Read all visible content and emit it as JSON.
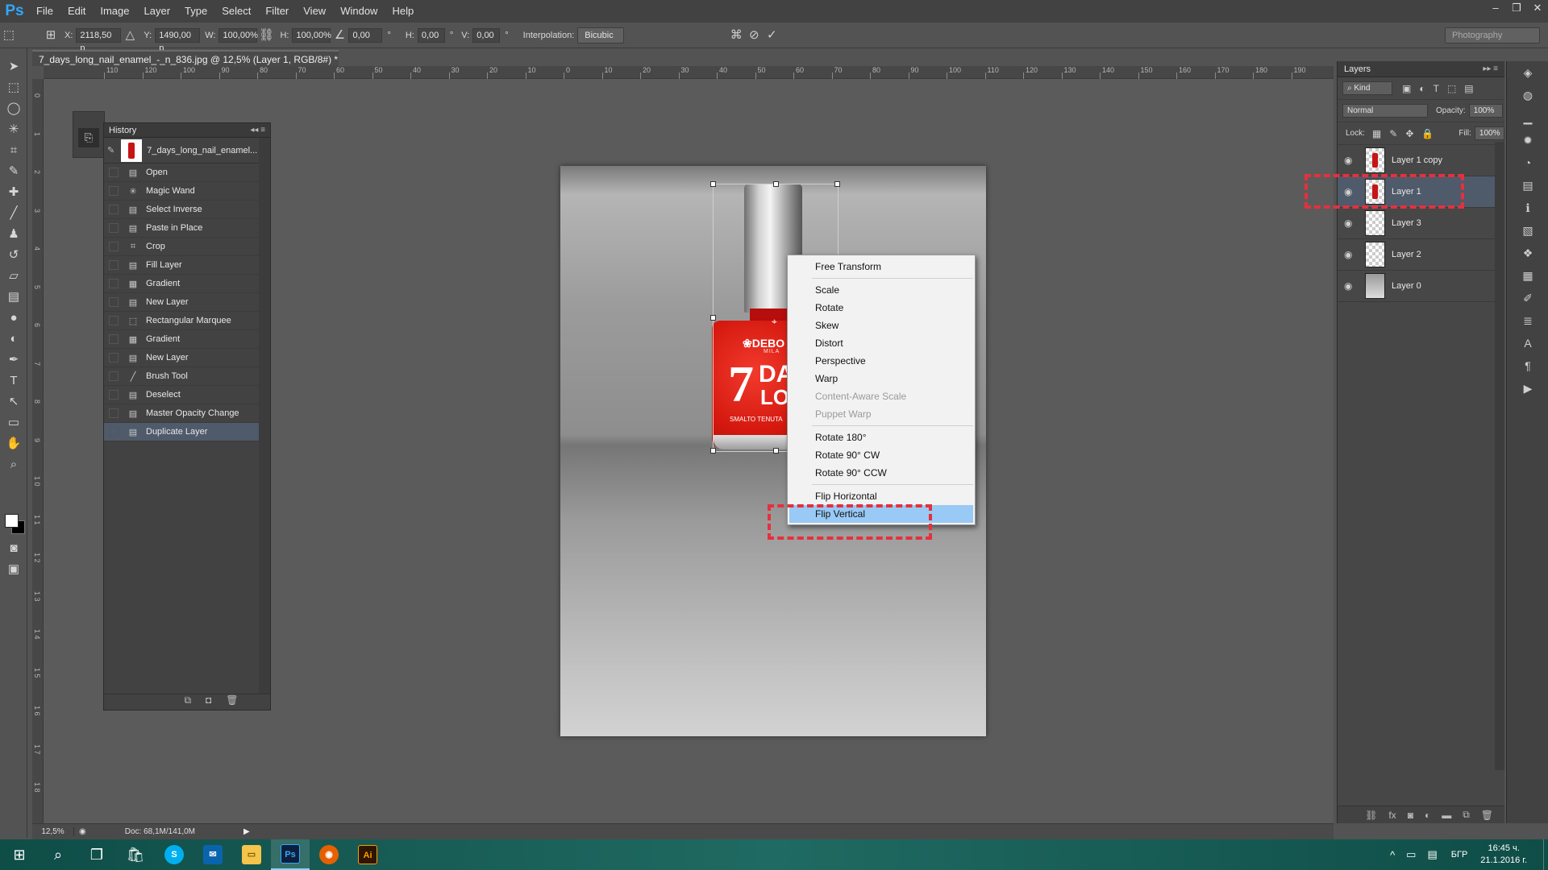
{
  "app": {
    "logo": "Ps",
    "workspace": "Photography"
  },
  "menu": [
    "File",
    "Edit",
    "Image",
    "Layer",
    "Type",
    "Select",
    "Filter",
    "View",
    "Window",
    "Help"
  ],
  "window_controls": [
    "–",
    "❐",
    "✕"
  ],
  "options": {
    "x_label": "X:",
    "x_value": "2118,50 p",
    "y_label": "Y:",
    "y_value": "1490,00 p",
    "w_label": "W:",
    "w_value": "100,00%",
    "h_label": "H:",
    "h_value": "100,00%",
    "angle_value": "0,00",
    "angle_unit": "°",
    "hskew_label": "H:",
    "hskew_value": "0,00",
    "hskew_unit": "°",
    "vskew_label": "V:",
    "vskew_value": "0,00",
    "vskew_unit": "°",
    "interp_label": "Interpolation:",
    "interp_value": "Bicubic"
  },
  "document": {
    "tab_title": "7_days_long_nail_enamel_-_n_836.jpg @ 12,5% (Layer 1, RGB/8#) *",
    "tab_close": "×",
    "bottle_brand": "❀DEBO",
    "bottle_brand_sub": "MILA",
    "bottle_number": "7",
    "bottle_days": "DA",
    "bottle_long": "LO",
    "bottle_tagline": "SMALTO TENUTA"
  },
  "rulers": {
    "h": [
      "110",
      "120",
      "100",
      "90",
      "80",
      "70",
      "60",
      "50",
      "40",
      "30",
      "20",
      "10",
      "0",
      "10",
      "20",
      "30",
      "40",
      "50",
      "60",
      "70",
      "80",
      "90",
      "100",
      "110",
      "120",
      "130",
      "140",
      "150",
      "160",
      "170",
      "180",
      "190",
      "20"
    ],
    "v": [
      "0",
      "1",
      "2",
      "3",
      "4",
      "5",
      "6",
      "7",
      "8",
      "9",
      "1 0",
      "1 1",
      "1 2",
      "1 3",
      "1 4",
      "1 5",
      "1 6",
      "1 7",
      "1 8"
    ]
  },
  "context_menu": [
    {
      "label": "Free Transform",
      "state": "normal"
    },
    {
      "sep": true
    },
    {
      "label": "Scale",
      "state": "normal"
    },
    {
      "label": "Rotate",
      "state": "normal"
    },
    {
      "label": "Skew",
      "state": "normal"
    },
    {
      "label": "Distort",
      "state": "normal"
    },
    {
      "label": "Perspective",
      "state": "normal"
    },
    {
      "label": "Warp",
      "state": "normal"
    },
    {
      "label": "Content-Aware Scale",
      "state": "disabled"
    },
    {
      "label": "Puppet Warp",
      "state": "disabled"
    },
    {
      "sep": true
    },
    {
      "label": "Rotate 180°",
      "state": "normal"
    },
    {
      "label": "Rotate 90° CW",
      "state": "normal"
    },
    {
      "label": "Rotate 90° CCW",
      "state": "normal"
    },
    {
      "sep": true
    },
    {
      "label": "Flip Horizontal",
      "state": "normal"
    },
    {
      "label": "Flip Vertical",
      "state": "active"
    }
  ],
  "history": {
    "title": "History",
    "snapshot_label": "7_days_long_nail_enamel...",
    "items": [
      {
        "label": "Open",
        "icon": "▤",
        "selected": false
      },
      {
        "label": "Magic Wand",
        "icon": "✳",
        "selected": false
      },
      {
        "label": "Select Inverse",
        "icon": "▤",
        "selected": false
      },
      {
        "label": "Paste in Place",
        "icon": "▤",
        "selected": false
      },
      {
        "label": "Crop",
        "icon": "⌗",
        "selected": false
      },
      {
        "label": "Fill Layer",
        "icon": "▤",
        "selected": false
      },
      {
        "label": "Gradient",
        "icon": "▦",
        "selected": false
      },
      {
        "label": "New Layer",
        "icon": "▤",
        "selected": false
      },
      {
        "label": "Rectangular Marquee",
        "icon": "⬚",
        "selected": false
      },
      {
        "label": "Gradient",
        "icon": "▦",
        "selected": false
      },
      {
        "label": "New Layer",
        "icon": "▤",
        "selected": false
      },
      {
        "label": "Brush Tool",
        "icon": "╱",
        "selected": false
      },
      {
        "label": "Deselect",
        "icon": "▤",
        "selected": false
      },
      {
        "label": "Master Opacity Change",
        "icon": "▤",
        "selected": false
      },
      {
        "label": "Duplicate Layer",
        "icon": "▤",
        "selected": true
      }
    ]
  },
  "layers": {
    "title": "Layers",
    "kind_label": "Kind",
    "blend_mode": "Normal",
    "opacity_label": "Opacity:",
    "opacity_value": "100%",
    "lock_label": "Lock:",
    "fill_label": "Fill:",
    "fill_value": "100%",
    "items": [
      {
        "name": "Layer 1 copy",
        "thumb": "bottle",
        "selected": false
      },
      {
        "name": "Layer 1",
        "thumb": "bottle",
        "selected": true
      },
      {
        "name": "Layer 3",
        "thumb": "transparent",
        "selected": false
      },
      {
        "name": "Layer 2",
        "thumb": "transparent",
        "selected": false
      },
      {
        "name": "Layer 0",
        "thumb": "grad",
        "selected": false
      }
    ]
  },
  "status": {
    "zoom": "12,5%",
    "doc": "Doc: 68,1M/141,0M"
  },
  "taskbar": {
    "lang": "БГР",
    "time": "16:45 ч.",
    "date": "21.1.2016 г.",
    "apps": [
      "Skype",
      "Outlook",
      "Explorer",
      "Photoshop",
      "Firefox",
      "Illustrator"
    ]
  }
}
